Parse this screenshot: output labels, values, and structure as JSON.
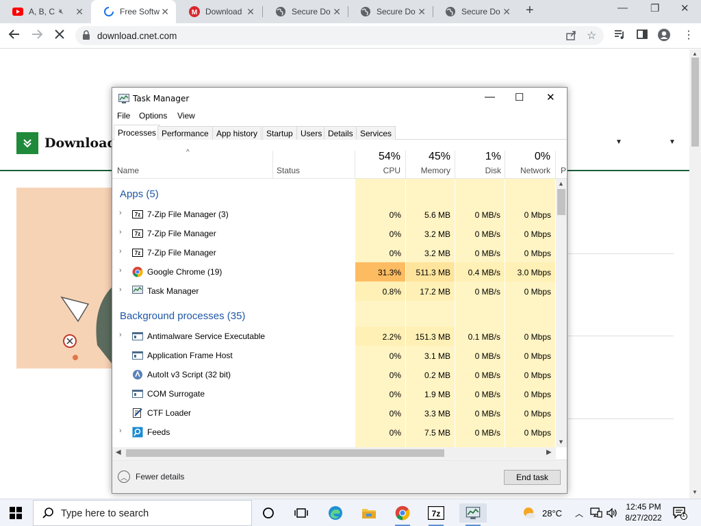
{
  "browser": {
    "tabs": [
      {
        "title": "A, B, C",
        "favicon": "youtube-icon",
        "muted": true,
        "active": false
      },
      {
        "title": "Free Softw",
        "favicon": "loading-spinner-icon",
        "active": true
      },
      {
        "title": "Download",
        "favicon": "mega-icon",
        "active": false
      },
      {
        "title": "Secure Do",
        "favicon": "globe-icon",
        "active": false
      },
      {
        "title": "Secure Do",
        "favicon": "globe-icon",
        "active": false
      },
      {
        "title": "Secure Do",
        "favicon": "globe-icon",
        "active": false
      }
    ],
    "url": "download.cnet.com"
  },
  "page": {
    "logo_text": "Download"
  },
  "task_manager": {
    "title": "Task Manager",
    "menu": [
      "File",
      "Options",
      "View"
    ],
    "tabs": [
      "Processes",
      "Performance",
      "App history",
      "Startup",
      "Users",
      "Details",
      "Services"
    ],
    "columns": {
      "name": "Name",
      "status": "Status",
      "cpu": {
        "pct": "54%",
        "label": "CPU"
      },
      "memory": {
        "pct": "45%",
        "label": "Memory"
      },
      "disk": {
        "pct": "1%",
        "label": "Disk"
      },
      "network": {
        "pct": "0%",
        "label": "Network"
      },
      "power_partial": "P"
    },
    "groups": {
      "apps": "Apps (5)",
      "background": "Background processes (35)"
    },
    "apps": [
      {
        "name": "7-Zip File Manager (3)",
        "icon": "7zip-icon",
        "expandable": true,
        "cpu": "0%",
        "memory": "5.6 MB",
        "disk": "0 MB/s",
        "network": "0 Mbps"
      },
      {
        "name": "7-Zip File Manager",
        "icon": "7zip-icon",
        "expandable": true,
        "cpu": "0%",
        "memory": "3.2 MB",
        "disk": "0 MB/s",
        "network": "0 Mbps"
      },
      {
        "name": "7-Zip File Manager",
        "icon": "7zip-icon",
        "expandable": true,
        "cpu": "0%",
        "memory": "3.2 MB",
        "disk": "0 MB/s",
        "network": "0 Mbps"
      },
      {
        "name": "Google Chrome (19)",
        "icon": "chrome-icon",
        "expandable": true,
        "cpu": "31.3%",
        "memory": "511.3 MB",
        "disk": "0.4 MB/s",
        "network": "3.0 Mbps"
      },
      {
        "name": "Task Manager",
        "icon": "task-manager-icon",
        "expandable": true,
        "cpu": "0.8%",
        "memory": "17.2 MB",
        "disk": "0 MB/s",
        "network": "0 Mbps"
      }
    ],
    "background": [
      {
        "name": "Antimalware Service Executable",
        "icon": "service-window-icon",
        "expandable": true,
        "cpu": "2.2%",
        "memory": "151.3 MB",
        "disk": "0.1 MB/s",
        "network": "0 Mbps"
      },
      {
        "name": "Application Frame Host",
        "icon": "service-window-icon",
        "expandable": false,
        "cpu": "0%",
        "memory": "3.1 MB",
        "disk": "0 MB/s",
        "network": "0 Mbps"
      },
      {
        "name": "AutoIt v3 Script (32 bit)",
        "icon": "autoit-icon",
        "expandable": false,
        "cpu": "0%",
        "memory": "0.2 MB",
        "disk": "0 MB/s",
        "network": "0 Mbps"
      },
      {
        "name": "COM Surrogate",
        "icon": "service-window-icon",
        "expandable": false,
        "cpu": "0%",
        "memory": "1.9 MB",
        "disk": "0 MB/s",
        "network": "0 Mbps"
      },
      {
        "name": "CTF Loader",
        "icon": "ctf-loader-icon",
        "expandable": false,
        "cpu": "0%",
        "memory": "3.3 MB",
        "disk": "0 MB/s",
        "network": "0 Mbps"
      },
      {
        "name": "Feeds",
        "icon": "feeds-icon",
        "expandable": true,
        "cpu": "0%",
        "memory": "7.5 MB",
        "disk": "0 MB/s",
        "network": "0 Mbps"
      }
    ],
    "fewer_details": "Fewer details",
    "end_task": "End task"
  },
  "taskbar": {
    "search_placeholder": "Type here to search",
    "weather": "28°C",
    "time": "12:45 PM",
    "date": "8/27/2022",
    "notification_count": "1"
  }
}
